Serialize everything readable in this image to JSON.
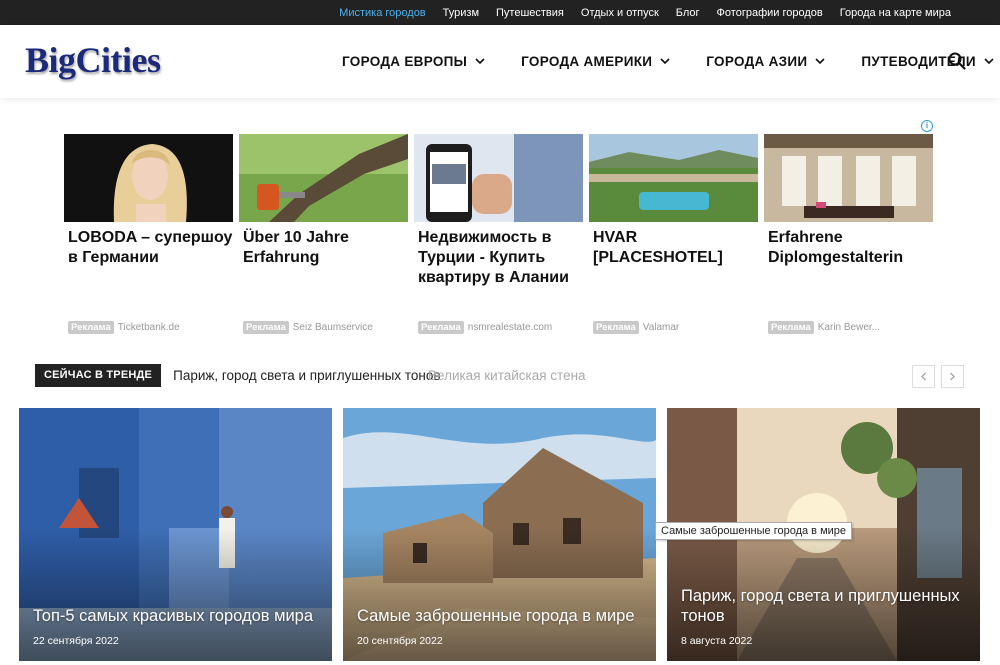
{
  "topbar": {
    "links": [
      "Мистика городов",
      "Туризм",
      "Путешествия",
      "Отдых и отпуск",
      "Блог",
      "Фотографии городов",
      "Города на карте мира"
    ]
  },
  "header": {
    "logo": "BigCities",
    "nav": [
      "ГОРОДА ЕВРОПЫ",
      "ГОРОДА АМЕРИКИ",
      "ГОРОДА АЗИИ",
      "ПУТЕВОДИТЕЛИ"
    ]
  },
  "ads": {
    "info_glyph": "i",
    "items": [
      {
        "title": "LOBODA – супершоу в Германии",
        "badge": "Реклама",
        "source": "Ticketbank.de"
      },
      {
        "title": "Über 10 Jahre Erfahrung",
        "badge": "Реклама",
        "source": "Seiz Baumservice"
      },
      {
        "title": "Недвижимость в Турции - Купить квартиру в Алании",
        "badge": "Реклама",
        "source": "nsmrealestate.com"
      },
      {
        "title": "HVAR [PLACESHOTEL]",
        "badge": "Реклама",
        "source": "Valamar"
      },
      {
        "title": "Erfahrene Diplomgestalterin",
        "badge": "Реклама",
        "source": "Karin Bewer..."
      }
    ]
  },
  "trending": {
    "label": "СЕЙЧАС В ТРЕНДЕ",
    "current": "Париж, город света и приглушенных тонов",
    "next": "Великая китайская стена"
  },
  "cards": [
    {
      "title": "Топ-5 самых красивых городов мира",
      "date": "22 сентября 2022"
    },
    {
      "title": "Самые заброшенные города в мире",
      "date": "20 сентября 2022"
    },
    {
      "title": "Париж, город света и приглушенных тонов",
      "date": "8 августа 2022"
    }
  ],
  "tooltip": "Самые заброшенные города в мире",
  "colors": {
    "topbar_bg": "#222222",
    "active_link": "#4db2ec",
    "logo": "#1b2a7a"
  }
}
